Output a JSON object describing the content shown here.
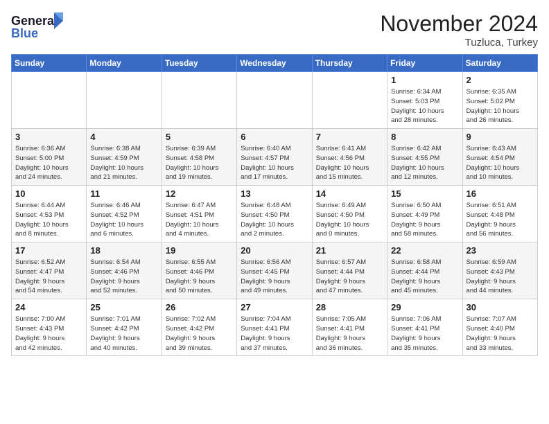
{
  "logo": {
    "line1": "General",
    "line2": "Blue"
  },
  "title": "November 2024",
  "location": "Tuzluca, Turkey",
  "weekdays": [
    "Sunday",
    "Monday",
    "Tuesday",
    "Wednesday",
    "Thursday",
    "Friday",
    "Saturday"
  ],
  "weeks": [
    [
      {
        "day": "",
        "info": ""
      },
      {
        "day": "",
        "info": ""
      },
      {
        "day": "",
        "info": ""
      },
      {
        "day": "",
        "info": ""
      },
      {
        "day": "",
        "info": ""
      },
      {
        "day": "1",
        "info": "Sunrise: 6:34 AM\nSunset: 5:03 PM\nDaylight: 10 hours\nand 28 minutes."
      },
      {
        "day": "2",
        "info": "Sunrise: 6:35 AM\nSunset: 5:02 PM\nDaylight: 10 hours\nand 26 minutes."
      }
    ],
    [
      {
        "day": "3",
        "info": "Sunrise: 6:36 AM\nSunset: 5:00 PM\nDaylight: 10 hours\nand 24 minutes."
      },
      {
        "day": "4",
        "info": "Sunrise: 6:38 AM\nSunset: 4:59 PM\nDaylight: 10 hours\nand 21 minutes."
      },
      {
        "day": "5",
        "info": "Sunrise: 6:39 AM\nSunset: 4:58 PM\nDaylight: 10 hours\nand 19 minutes."
      },
      {
        "day": "6",
        "info": "Sunrise: 6:40 AM\nSunset: 4:57 PM\nDaylight: 10 hours\nand 17 minutes."
      },
      {
        "day": "7",
        "info": "Sunrise: 6:41 AM\nSunset: 4:56 PM\nDaylight: 10 hours\nand 15 minutes."
      },
      {
        "day": "8",
        "info": "Sunrise: 6:42 AM\nSunset: 4:55 PM\nDaylight: 10 hours\nand 12 minutes."
      },
      {
        "day": "9",
        "info": "Sunrise: 6:43 AM\nSunset: 4:54 PM\nDaylight: 10 hours\nand 10 minutes."
      }
    ],
    [
      {
        "day": "10",
        "info": "Sunrise: 6:44 AM\nSunset: 4:53 PM\nDaylight: 10 hours\nand 8 minutes."
      },
      {
        "day": "11",
        "info": "Sunrise: 6:46 AM\nSunset: 4:52 PM\nDaylight: 10 hours\nand 6 minutes."
      },
      {
        "day": "12",
        "info": "Sunrise: 6:47 AM\nSunset: 4:51 PM\nDaylight: 10 hours\nand 4 minutes."
      },
      {
        "day": "13",
        "info": "Sunrise: 6:48 AM\nSunset: 4:50 PM\nDaylight: 10 hours\nand 2 minutes."
      },
      {
        "day": "14",
        "info": "Sunrise: 6:49 AM\nSunset: 4:50 PM\nDaylight: 10 hours\nand 0 minutes."
      },
      {
        "day": "15",
        "info": "Sunrise: 6:50 AM\nSunset: 4:49 PM\nDaylight: 9 hours\nand 58 minutes."
      },
      {
        "day": "16",
        "info": "Sunrise: 6:51 AM\nSunset: 4:48 PM\nDaylight: 9 hours\nand 56 minutes."
      }
    ],
    [
      {
        "day": "17",
        "info": "Sunrise: 6:52 AM\nSunset: 4:47 PM\nDaylight: 9 hours\nand 54 minutes."
      },
      {
        "day": "18",
        "info": "Sunrise: 6:54 AM\nSunset: 4:46 PM\nDaylight: 9 hours\nand 52 minutes."
      },
      {
        "day": "19",
        "info": "Sunrise: 6:55 AM\nSunset: 4:46 PM\nDaylight: 9 hours\nand 50 minutes."
      },
      {
        "day": "20",
        "info": "Sunrise: 6:56 AM\nSunset: 4:45 PM\nDaylight: 9 hours\nand 49 minutes."
      },
      {
        "day": "21",
        "info": "Sunrise: 6:57 AM\nSunset: 4:44 PM\nDaylight: 9 hours\nand 47 minutes."
      },
      {
        "day": "22",
        "info": "Sunrise: 6:58 AM\nSunset: 4:44 PM\nDaylight: 9 hours\nand 45 minutes."
      },
      {
        "day": "23",
        "info": "Sunrise: 6:59 AM\nSunset: 4:43 PM\nDaylight: 9 hours\nand 44 minutes."
      }
    ],
    [
      {
        "day": "24",
        "info": "Sunrise: 7:00 AM\nSunset: 4:43 PM\nDaylight: 9 hours\nand 42 minutes."
      },
      {
        "day": "25",
        "info": "Sunrise: 7:01 AM\nSunset: 4:42 PM\nDaylight: 9 hours\nand 40 minutes."
      },
      {
        "day": "26",
        "info": "Sunrise: 7:02 AM\nSunset: 4:42 PM\nDaylight: 9 hours\nand 39 minutes."
      },
      {
        "day": "27",
        "info": "Sunrise: 7:04 AM\nSunset: 4:41 PM\nDaylight: 9 hours\nand 37 minutes."
      },
      {
        "day": "28",
        "info": "Sunrise: 7:05 AM\nSunset: 4:41 PM\nDaylight: 9 hours\nand 36 minutes."
      },
      {
        "day": "29",
        "info": "Sunrise: 7:06 AM\nSunset: 4:41 PM\nDaylight: 9 hours\nand 35 minutes."
      },
      {
        "day": "30",
        "info": "Sunrise: 7:07 AM\nSunset: 4:40 PM\nDaylight: 9 hours\nand 33 minutes."
      }
    ]
  ]
}
